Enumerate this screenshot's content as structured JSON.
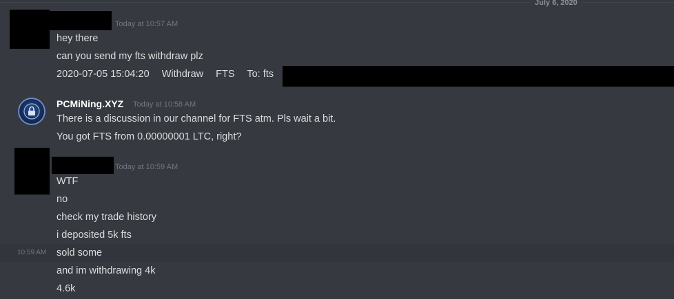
{
  "divider": {
    "date": "July 6, 2020"
  },
  "groups": {
    "g1": {
      "timestamp": "Today at 10:57 AM",
      "messages": [
        "hey there",
        "can you send my fts withdraw plz"
      ],
      "withdraw": {
        "datetime": "2020-07-05 15:04:20",
        "action": "Withdraw",
        "coin": "FTS",
        "to": "To: fts"
      }
    },
    "g2": {
      "username": "PCMiNing.XYZ",
      "timestamp": "Today at 10:58 AM",
      "messages": [
        "There is a discussion in our channel for FTS atm. Pls wait a bit.",
        "You got FTS from 0.00000001 LTC, right?"
      ]
    },
    "g3": {
      "timestamp": "Today at 10:59 AM",
      "hover_time": "10:59 AM",
      "messages": [
        "WTF",
        "no",
        "check my trade history",
        "i deposited 5k fts",
        "sold some",
        "and im withdrawing 4k",
        "4.6k"
      ]
    }
  },
  "colors": {
    "background": "#36393f",
    "text": "#dcddde",
    "username": "#ffffff",
    "timestamp": "#72767d",
    "hover_row": "#32353b"
  }
}
